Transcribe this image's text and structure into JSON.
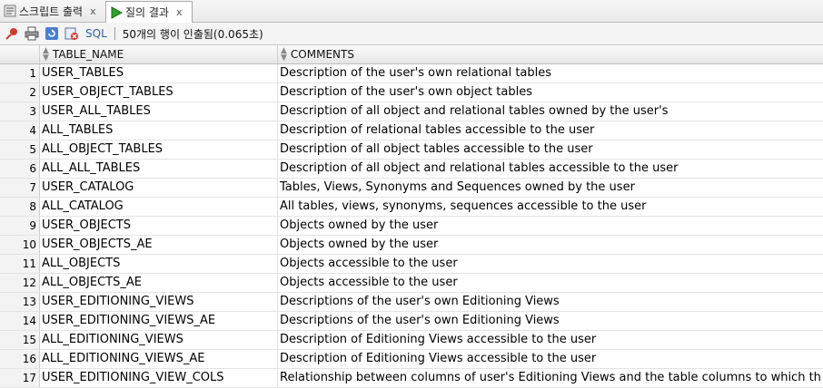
{
  "tabs": [
    {
      "label": "스크립트 출력",
      "close": "x"
    },
    {
      "label": "질의 결과",
      "close": "x"
    }
  ],
  "toolbar": {
    "sql_label": "SQL",
    "status": "50개의 행이 인출됨(0.065초)"
  },
  "columns": {
    "table_name": "TABLE_NAME",
    "comments": "COMMENTS"
  },
  "rows": [
    {
      "n": "1",
      "name": "USER_TABLES",
      "comment": "Description of the user's own relational tables"
    },
    {
      "n": "2",
      "name": "USER_OBJECT_TABLES",
      "comment": "Description of the user's own object tables"
    },
    {
      "n": "3",
      "name": "USER_ALL_TABLES",
      "comment": "Description of all object and relational tables owned by the user's"
    },
    {
      "n": "4",
      "name": "ALL_TABLES",
      "comment": "Description of relational tables accessible to the user"
    },
    {
      "n": "5",
      "name": "ALL_OBJECT_TABLES",
      "comment": "Description of all object tables accessible to the user"
    },
    {
      "n": "6",
      "name": "ALL_ALL_TABLES",
      "comment": "Description of all object and relational tables accessible to the user"
    },
    {
      "n": "7",
      "name": "USER_CATALOG",
      "comment": "Tables, Views, Synonyms and Sequences owned by the user"
    },
    {
      "n": "8",
      "name": "ALL_CATALOG",
      "comment": "All tables, views, synonyms, sequences accessible to the user"
    },
    {
      "n": "9",
      "name": "USER_OBJECTS",
      "comment": "Objects owned by the user"
    },
    {
      "n": "10",
      "name": "USER_OBJECTS_AE",
      "comment": "Objects owned by the user"
    },
    {
      "n": "11",
      "name": "ALL_OBJECTS",
      "comment": "Objects accessible to the user"
    },
    {
      "n": "12",
      "name": "ALL_OBJECTS_AE",
      "comment": "Objects accessible to the user"
    },
    {
      "n": "13",
      "name": "USER_EDITIONING_VIEWS",
      "comment": "Descriptions of the user's own Editioning Views"
    },
    {
      "n": "14",
      "name": "USER_EDITIONING_VIEWS_AE",
      "comment": "Descriptions of the user's own Editioning Views"
    },
    {
      "n": "15",
      "name": "ALL_EDITIONING_VIEWS",
      "comment": "Description of Editioning Views accessible to the user"
    },
    {
      "n": "16",
      "name": "ALL_EDITIONING_VIEWS_AE",
      "comment": "Description of Editioning Views accessible to the user"
    },
    {
      "n": "17",
      "name": "USER_EDITIONING_VIEW_COLS",
      "comment": "Relationship between columns of user's Editioning Views and the table columns to which th"
    }
  ]
}
